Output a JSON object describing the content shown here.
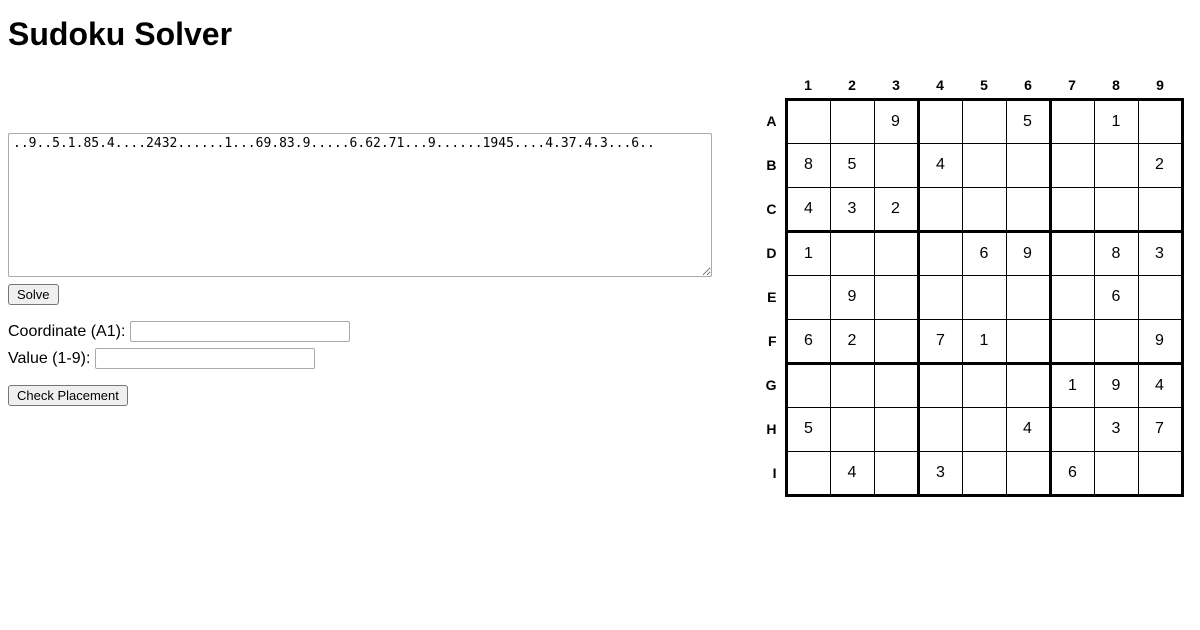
{
  "title": "Sudoku Solver",
  "puzzle_string": "..9..5.1.85.4....2432......1...69.83.9.....6.62.71...9......1945....4.37.4.3...6..",
  "solve_button": "Solve",
  "coordinate_label": "Coordinate (A1):",
  "coordinate_value": "",
  "value_label": "Value (1-9):",
  "value_value": "",
  "check_button": "Check Placement",
  "col_headers": [
    "1",
    "2",
    "3",
    "4",
    "5",
    "6",
    "7",
    "8",
    "9"
  ],
  "row_headers": [
    "A",
    "B",
    "C",
    "D",
    "E",
    "F",
    "G",
    "H",
    "I"
  ],
  "grid": [
    [
      "",
      "",
      "9",
      "",
      "",
      "5",
      "",
      "1",
      ""
    ],
    [
      "8",
      "5",
      "",
      "4",
      "",
      "",
      "",
      "",
      "2"
    ],
    [
      "4",
      "3",
      "2",
      "",
      "",
      "",
      "",
      "",
      ""
    ],
    [
      "1",
      "",
      "",
      "",
      "6",
      "9",
      "",
      "8",
      "3"
    ],
    [
      "",
      "9",
      "",
      "",
      "",
      "",
      "",
      "6",
      ""
    ],
    [
      "6",
      "2",
      "",
      "7",
      "1",
      "",
      "",
      "",
      "9"
    ],
    [
      "",
      "",
      "",
      "",
      "",
      "",
      "1",
      "9",
      "4"
    ],
    [
      "5",
      "",
      "",
      "",
      "",
      "4",
      "",
      "3",
      "7"
    ],
    [
      "",
      "4",
      "",
      "3",
      "",
      "",
      "6",
      "",
      ""
    ]
  ]
}
